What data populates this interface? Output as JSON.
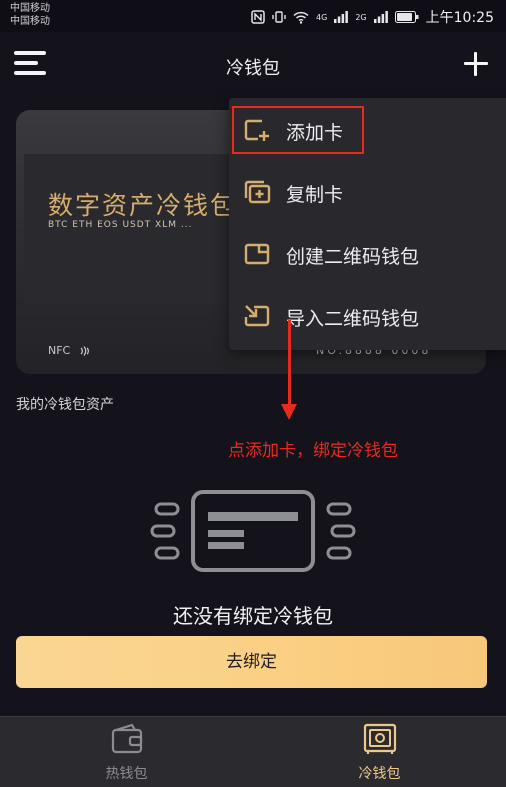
{
  "status_bar": {
    "carrier_1": "中国移动",
    "carrier_2": "中国移动",
    "signal_1_label": "4G",
    "signal_2_label": "2G",
    "time": "上午10:25"
  },
  "nav": {
    "title": "冷钱包",
    "menu_icon": "hamburger-icon",
    "add_icon": "plus-icon"
  },
  "card": {
    "title": "数字资产冷钱包",
    "coins": "BTC ETH EOS USDT XLM ...",
    "nfc_label": "NFC",
    "card_number": "NO.8888 0008"
  },
  "assets_label": "我的冷钱包资产",
  "dropdown": {
    "items": [
      {
        "label": "添加卡",
        "icon": "add-card-icon"
      },
      {
        "label": "复制卡",
        "icon": "copy-card-icon"
      },
      {
        "label": "创建二维码钱包",
        "icon": "create-qr-wallet-icon"
      },
      {
        "label": "导入二维码钱包",
        "icon": "import-qr-wallet-icon"
      }
    ]
  },
  "annotation": {
    "text": "点添加卡，绑定冷钱包",
    "color": "#e8291d"
  },
  "empty_state": {
    "text": "还没有绑定冷钱包",
    "button_label": "去绑定"
  },
  "tabbar": {
    "tabs": [
      {
        "label": "热钱包",
        "icon": "hot-wallet-icon",
        "active": false
      },
      {
        "label": "冷钱包",
        "icon": "cold-wallet-icon",
        "active": true
      }
    ]
  },
  "colors": {
    "background": "#14131c",
    "gold_accent": "#d6ad6c",
    "button_gradient_start": "#f9d693",
    "highlight_red": "#e8291d"
  }
}
